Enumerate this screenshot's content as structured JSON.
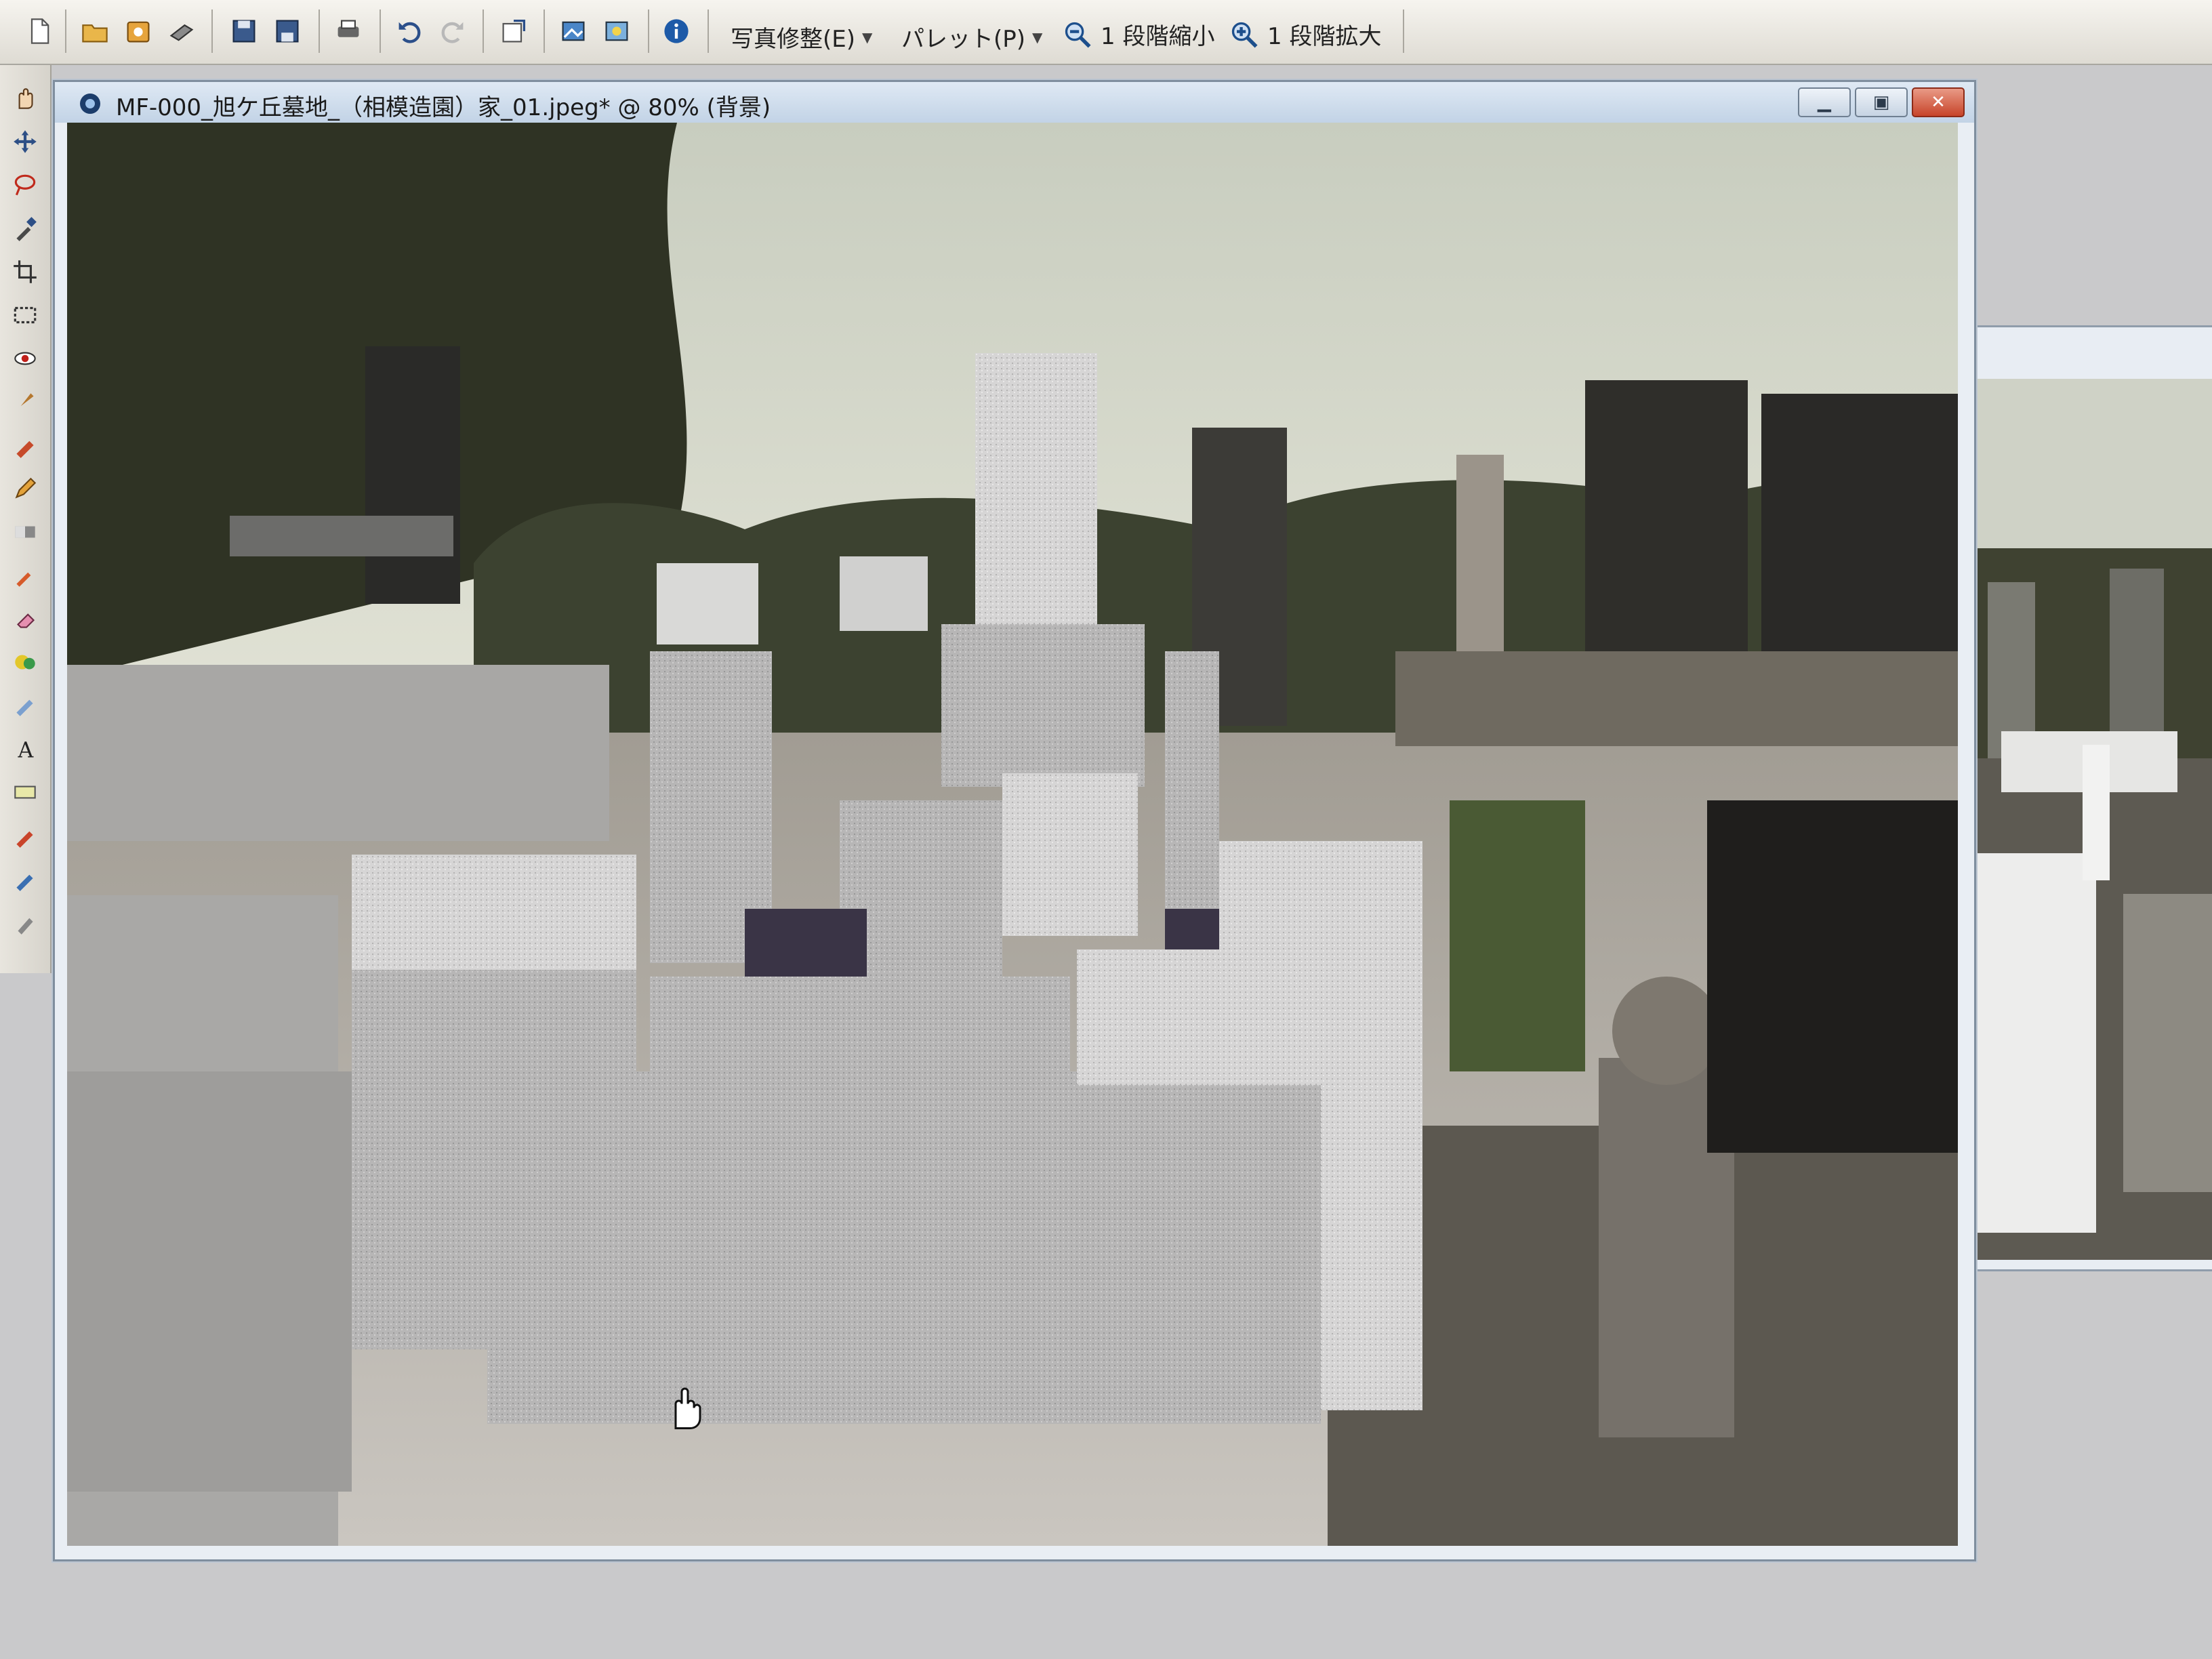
{
  "toolbar": {
    "photo_edit_menu": "写真修整(E)",
    "palette_menu": "パレット(P)",
    "zoom_out_label": "1 段階縮小",
    "zoom_in_label": "1 段階拡大"
  },
  "window": {
    "title": "MF-000_旭ケ丘墓地_（相模造園）家_01.jpeg* @ 80% (背景)",
    "minimize": "▁",
    "maximize": "▣",
    "close": "✕"
  },
  "icons": {
    "toolbar": [
      "new-file-icon",
      "open-folder-icon",
      "browse-icon",
      "scan-icon",
      "save-icon",
      "save-as-icon",
      "print-icon",
      "undo-icon",
      "redo-icon",
      "resize-icon",
      "adjust-icon",
      "adjust2-icon",
      "info-icon"
    ],
    "tools": [
      "hand-tool-icon",
      "move-tool-icon",
      "lasso-tool-icon",
      "eyedropper-tool-icon",
      "crop-tool-icon",
      "rectangle-select-icon",
      "red-eye-tool-icon",
      "brush-tool-icon",
      "clone-tool-icon",
      "pencil-tool-icon",
      "gradient-tool-icon",
      "paint-bucket-icon",
      "eraser-tool-icon",
      "shape-tool-icon",
      "text-tool-icon",
      "sharpen-tool-icon",
      "dodge-tool-icon",
      "sponge-tool-icon"
    ]
  },
  "colors": {
    "sky": "#d9ddd0",
    "granite": "#b9b8b8",
    "foliage": "#3a3f2c"
  }
}
